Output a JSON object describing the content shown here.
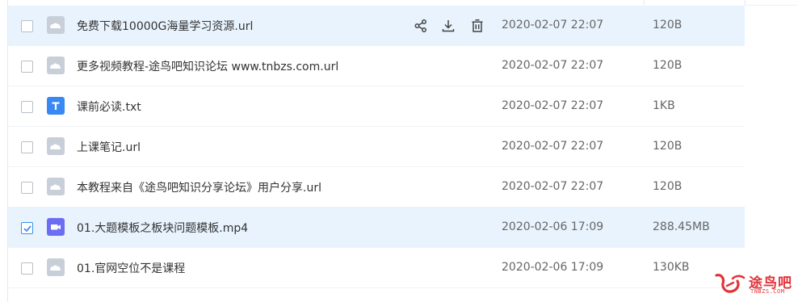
{
  "files": [
    {
      "name": "免费下载10000G海量学习资源.url",
      "date": "2020-02-07 22:07",
      "size": "120B",
      "type": "url",
      "icon": "link-file-icon",
      "checked": false
    },
    {
      "name": "更多视频教程-途鸟吧知识论坛 www.tnbzs.com.url",
      "date": "2020-02-07 22:07",
      "size": "120B",
      "type": "url",
      "icon": "link-file-icon",
      "checked": false
    },
    {
      "name": "课前必读.txt",
      "date": "2020-02-07 22:07",
      "size": "1KB",
      "type": "txt",
      "icon": "text-file-icon",
      "checked": false
    },
    {
      "name": "上课笔记.url",
      "date": "2020-02-07 22:07",
      "size": "120B",
      "type": "url",
      "icon": "link-file-icon",
      "checked": false
    },
    {
      "name": "本教程来自《途鸟吧知识分享论坛》用户分享.url",
      "date": "2020-02-07 22:07",
      "size": "120B",
      "type": "url",
      "icon": "link-file-icon",
      "checked": false
    },
    {
      "name": "01.大题模板之板块问题模板.mp4",
      "date": "2020-02-06 17:09",
      "size": "288.45MB",
      "type": "mp4",
      "icon": "video-file-icon",
      "checked": true
    },
    {
      "name": "01.官网空位不是课程",
      "date": "2020-02-06 17:09",
      "size": "130KB",
      "type": "url",
      "icon": "link-file-icon",
      "checked": false
    }
  ],
  "row_actions": [
    "share-icon",
    "download-icon",
    "delete-icon"
  ],
  "watermark": {
    "text": "途鸟吧",
    "sub": "TNBZS.COM"
  },
  "colors": {
    "row_highlight": "#e8f3fd",
    "checkbox_accent": "#3b8ff0",
    "txt_icon": "#3a88f3",
    "video_icon": "#6c6ef2",
    "link_icon": "#c8cfd8",
    "watermark": "#e2333a"
  }
}
